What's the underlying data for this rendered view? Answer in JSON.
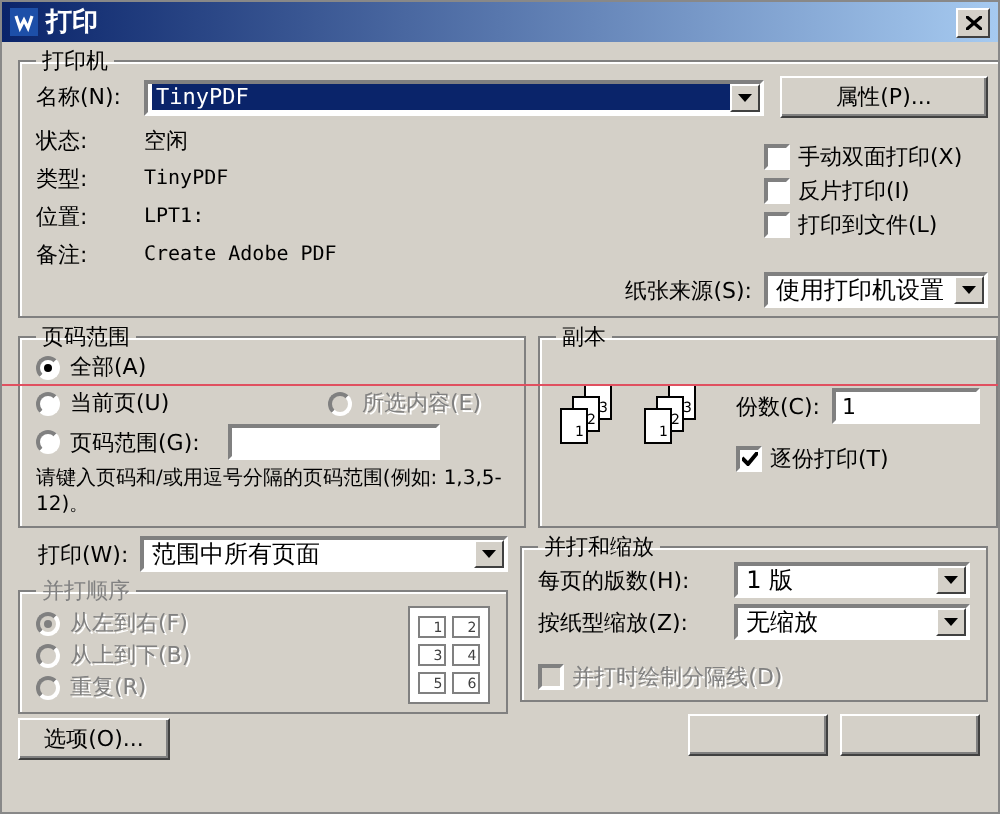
{
  "window": {
    "title": "打印"
  },
  "printer": {
    "group_title": "打印机",
    "name_label": "名称(N):",
    "name_value": "TinyPDF",
    "properties_button": "属性(P)...",
    "info": [
      {
        "label": "状态:",
        "value": "空闲"
      },
      {
        "label": "类型:",
        "value": "TinyPDF"
      },
      {
        "label": "位置:",
        "value": "LPT1:"
      },
      {
        "label": "备注:",
        "value": "Create Adobe PDF"
      }
    ],
    "options": [
      {
        "label": "手动双面打印(X)",
        "checked": false
      },
      {
        "label": "反片打印(I)",
        "checked": false
      },
      {
        "label": "打印到文件(L)",
        "checked": false
      }
    ],
    "source_label": "纸张来源(S):",
    "source_value": "使用打印机设置"
  },
  "page_range": {
    "group_title": "页码范围",
    "options": [
      {
        "label": "全部(A)",
        "selected": true,
        "disabled": false
      },
      {
        "label": "当前页(U)",
        "selected": false,
        "disabled": false
      },
      {
        "label": "所选内容(E)",
        "selected": false,
        "disabled": true
      },
      {
        "label": "页码范围(G):",
        "selected": false,
        "disabled": false
      }
    ],
    "hint": "请键入页码和/或用逗号分隔的页码范围(例如: 1,3,5-12)。"
  },
  "copies": {
    "group_title": "副本",
    "count_label": "份数(C):",
    "count_value": "1",
    "stacks": [
      [
        "1",
        "2",
        "3"
      ],
      [
        "1",
        "2",
        "3"
      ]
    ],
    "collate_label": "逐份打印(T)",
    "collate_checked": true
  },
  "print_what": {
    "label": "打印(W):",
    "value": "范围中所有页面"
  },
  "order": {
    "group_title": "并打顺序",
    "disabled": true,
    "options": [
      {
        "label": "从左到右(F)",
        "selected": true
      },
      {
        "label": "从上到下(B)",
        "selected": false
      },
      {
        "label": "重复(R)",
        "selected": false
      }
    ],
    "grid": [
      "1",
      "2",
      "3",
      "4",
      "5",
      "6"
    ]
  },
  "zoom": {
    "group_title": "并打和缩放",
    "pages_label": "每页的版数(H):",
    "pages_value": "1 版",
    "scale_label": "按纸型缩放(Z):",
    "scale_value": "无缩放",
    "separator_label": "并打时绘制分隔线(D)",
    "separator_checked": false,
    "separator_disabled": true
  },
  "options_button": "选项(O)..."
}
